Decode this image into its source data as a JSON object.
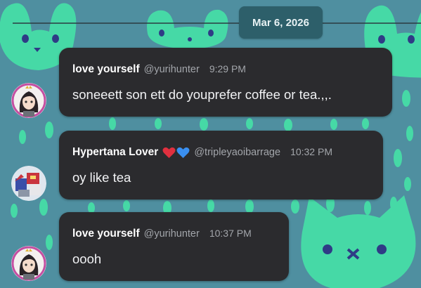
{
  "date_separator": {
    "label": "Mar 6, 2026"
  },
  "messages": [
    {
      "username": "love yourself",
      "handle": "@yurihunter",
      "time": "9:29 PM",
      "text": "soneeett son  ett do youprefer coffee or tea.,,.",
      "avatar": "anime-girl-avatar"
    },
    {
      "username": "Hypertana Lover",
      "handle": "@tripleyaoibarrage",
      "time": "10:32 PM",
      "text": "oy like tea",
      "decorations": [
        "red-heart-icon",
        "blue-heart-icon"
      ],
      "avatar": "robot-avatar"
    },
    {
      "username": "love yourself",
      "handle": "@yurihunter",
      "time": "10:37 PM",
      "text": "oooh",
      "avatar": "anime-girl-avatar"
    }
  ],
  "colors": {
    "background": "#4f8fa0",
    "pattern": "#46d9a6",
    "bubble": "#2b2b2e",
    "date_pill": "#2d5f6a",
    "heart_red": "#e0303f",
    "heart_blue": "#3a8ff0"
  }
}
